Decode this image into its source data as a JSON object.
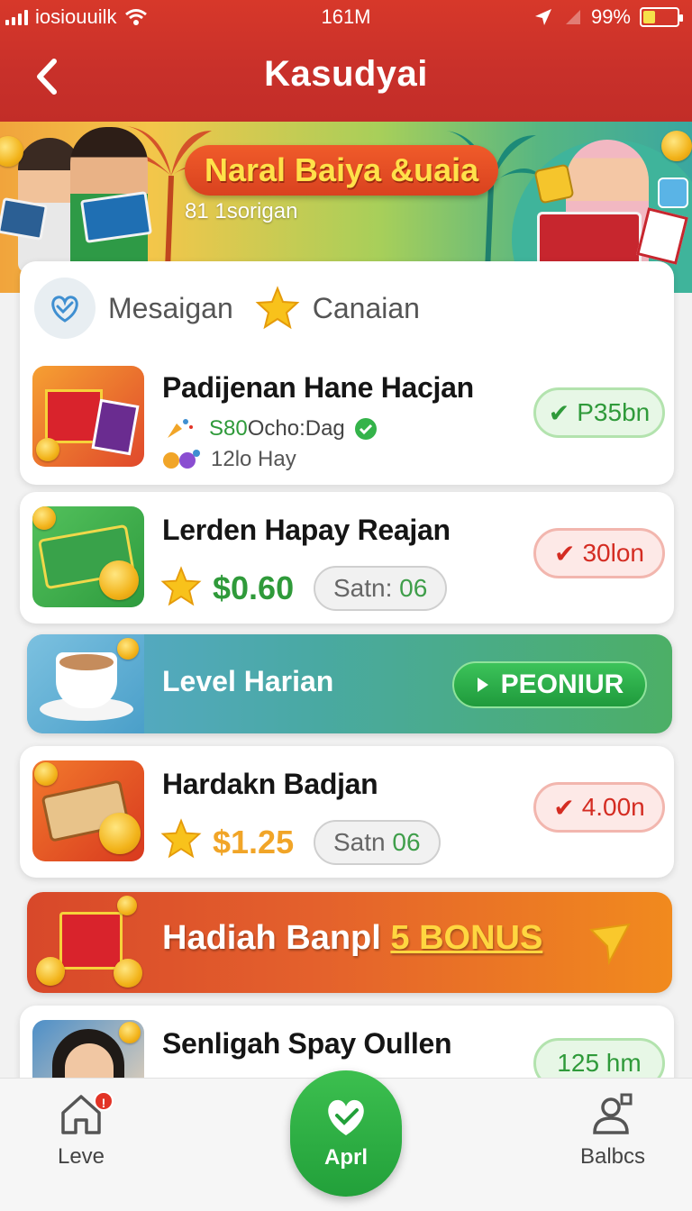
{
  "status_bar": {
    "carrier": "iosiouuilk",
    "time": "161M",
    "battery": "99%",
    "battery_level": 0.35
  },
  "header": {
    "title": "Kasudyai"
  },
  "banner": {
    "title": "Naral Baiya &uaia",
    "subtitle": "81 1sorigan"
  },
  "tabs": [
    {
      "label": "Mesaigan",
      "icon": "heart-hand-icon"
    },
    {
      "label": "Canaian",
      "icon": "star-icon"
    }
  ],
  "items": [
    {
      "title": "Padijenan Hane Hacjan",
      "line1_value": "S80",
      "line1_text": "Ocho:Dag",
      "line2_text": "12lo Hay",
      "status": "P35bn",
      "status_color": "#2f9a3a"
    },
    {
      "title": "Lerden Hapay Reajan",
      "price": "$0.60",
      "chip_label": "Satn:",
      "chip_value": "06",
      "status": "30lon",
      "status_color": "#d42c22"
    },
    {
      "title": "Hardakn Badjan",
      "price": "$1.25",
      "chip_label": "Satn",
      "chip_value": "06",
      "status": "4.00n",
      "status_color": "#d42c22"
    },
    {
      "title": "Senligah Spay Oullen",
      "status": "125 hm"
    }
  ],
  "level": {
    "label": "Level Harian",
    "button": "PEONIUR"
  },
  "bonus": {
    "text": "Hadiah Banpl",
    "highlight": "5 BONUS"
  },
  "bottom_nav": {
    "left": "Leve",
    "left_badge": "!",
    "center": "Aprl",
    "right": "Balbcs"
  },
  "colors": {
    "header_red": "#c8302a",
    "accent_green": "#22a03a",
    "price_green": "#2f9a3a",
    "price_orange": "#f1a528"
  }
}
